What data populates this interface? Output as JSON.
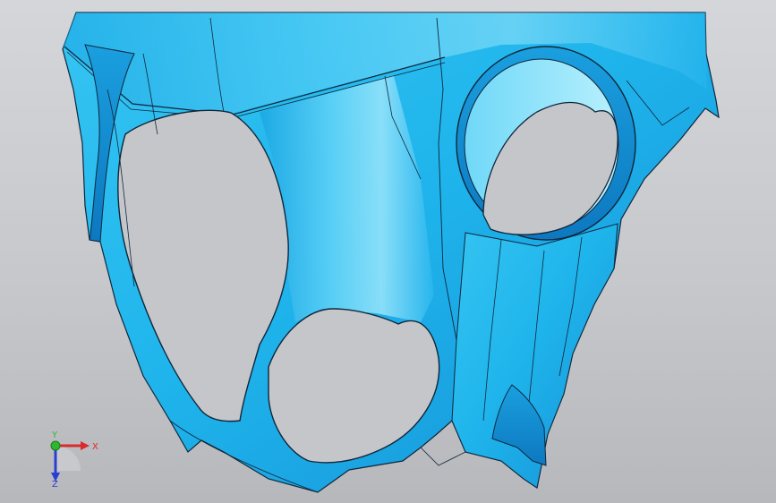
{
  "viewport": {
    "background_top": "#d4d6da",
    "background_bottom": "#b6b8bc",
    "model_color": "#1fb5ec",
    "model_highlight": "#8fe3fb",
    "model_shadow": "#0f7fc4",
    "edge_color": "#10263a"
  },
  "triad": {
    "x_label": "X",
    "y_label": "Y",
    "z_label": "Z",
    "x_color": "#d92b2b",
    "y_color": "#2fb82f",
    "z_color": "#2a3fd0"
  }
}
